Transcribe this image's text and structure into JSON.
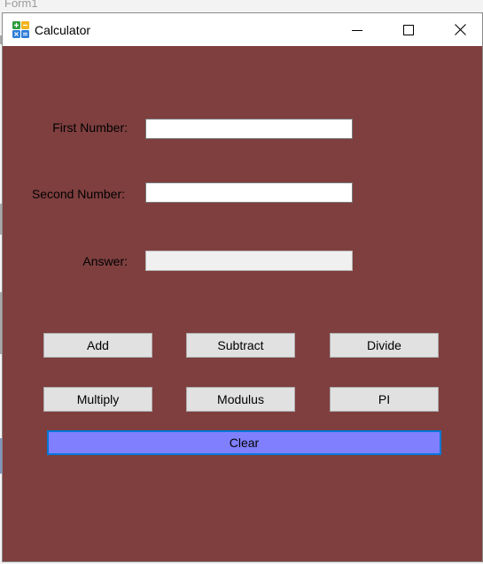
{
  "background_window": {
    "title": "Form1"
  },
  "window": {
    "title": "Calculator",
    "background_color": "#7f3f3f",
    "app_icon": "calculator-app-icon",
    "controls": {
      "minimize_icon": "minimize-icon",
      "maximize_icon": "maximize-icon",
      "close_icon": "close-icon"
    }
  },
  "form": {
    "first_number": {
      "label": "First Number:",
      "value": ""
    },
    "second_number": {
      "label": "Second Number:",
      "value": ""
    },
    "answer": {
      "label": "Answer:",
      "value": ""
    }
  },
  "buttons": {
    "add": "Add",
    "subtract": "Subtract",
    "divide": "Divide",
    "multiply": "Multiply",
    "modulus": "Modulus",
    "pi": "PI",
    "clear": "Clear"
  },
  "colors": {
    "clear_button": "#8080ff",
    "clear_button_border": "#0078d7",
    "button_face": "#e1e1e1"
  }
}
